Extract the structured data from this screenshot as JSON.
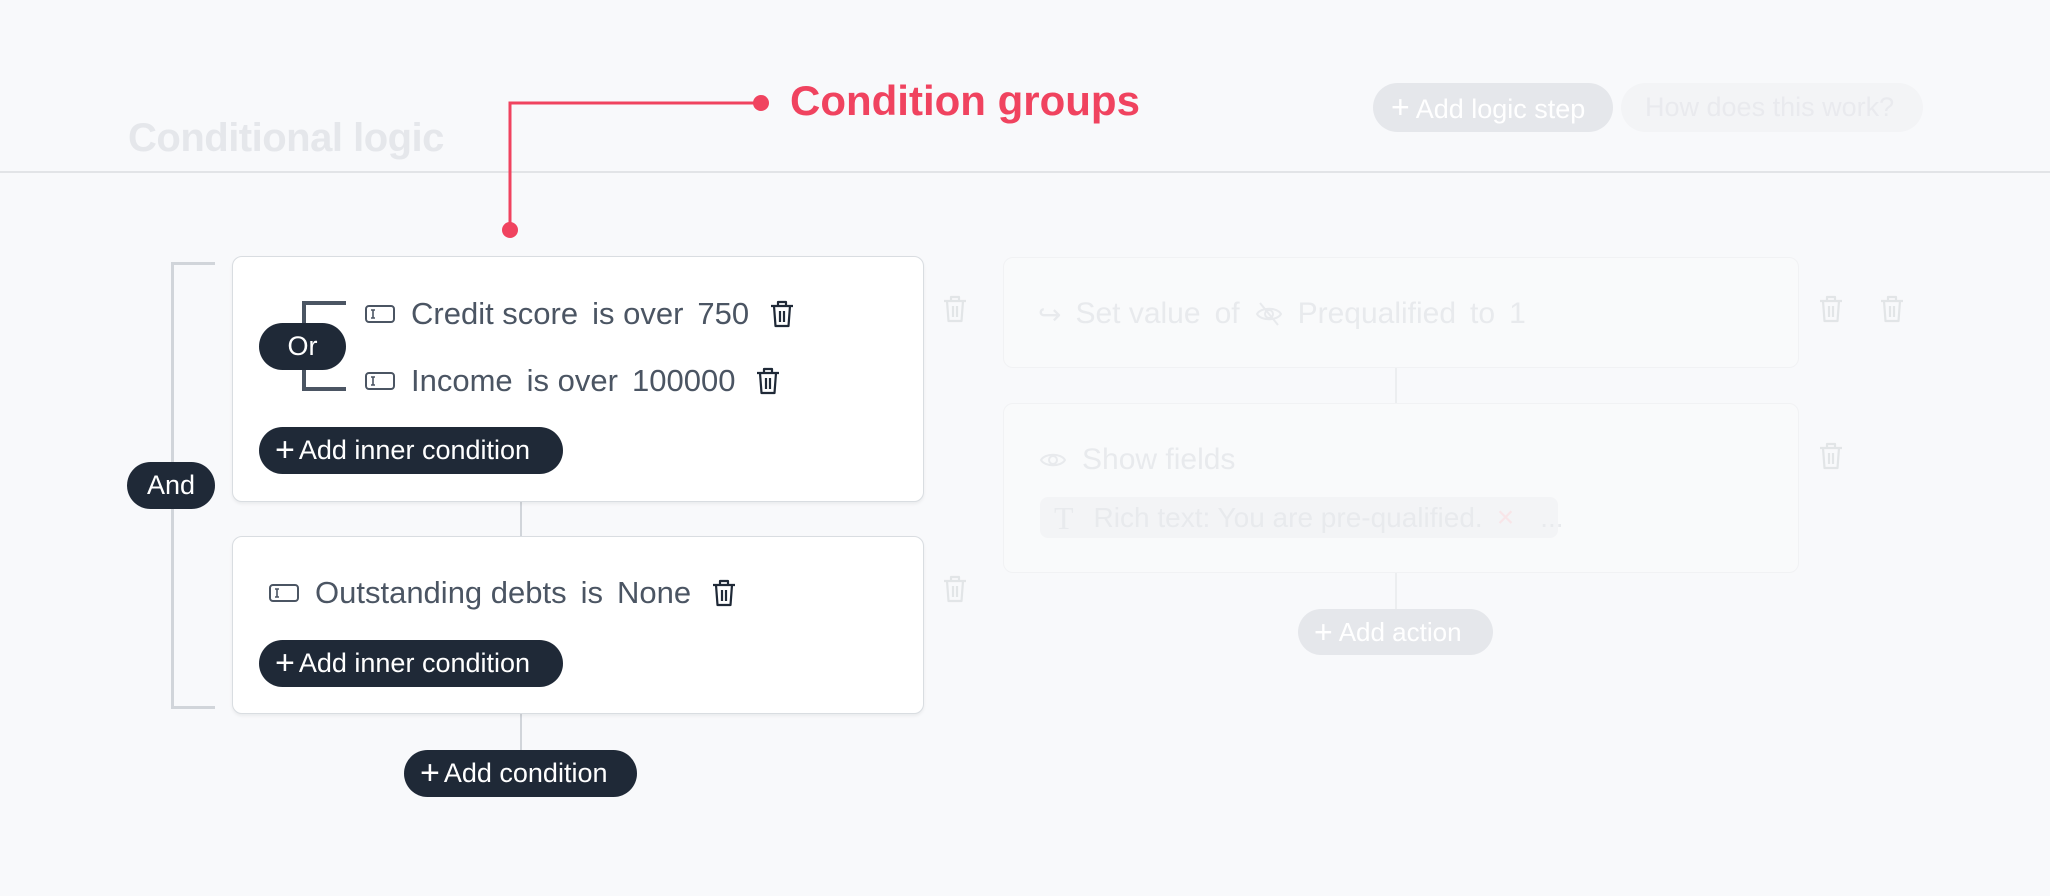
{
  "header": {
    "title": "Conditional logic",
    "add_logic_step_label": "Add logic step",
    "help_label": "How does this work?"
  },
  "annotation": {
    "label": "Condition groups",
    "color": "#F0435F"
  },
  "conditions": {
    "outer_operator": "And",
    "groups": [
      {
        "inner_operator": "Or",
        "rows": [
          {
            "field": "Credit score",
            "operator": "is over",
            "value": "750"
          },
          {
            "field": "Income",
            "operator": "is over",
            "value": "100000"
          }
        ],
        "add_inner_label": "Add inner condition"
      },
      {
        "rows": [
          {
            "field": "Outstanding debts",
            "operator": "is",
            "value": "None"
          }
        ],
        "add_inner_label": "Add inner condition"
      }
    ],
    "add_condition_label": "Add condition"
  },
  "actions": {
    "items": [
      {
        "verb": "Set value",
        "of": "of",
        "field": "Prequalified",
        "to": "to",
        "value": "1"
      },
      {
        "verb": "Show fields",
        "chip_label": "Rich text: You are pre-qualified.",
        "more": "..."
      }
    ],
    "add_action_label": "Add action"
  },
  "icons": {
    "plus": "+",
    "remove": "×"
  },
  "colors": {
    "dark": "#1F2937",
    "text": "#4B5563",
    "accent": "#F0435F"
  }
}
